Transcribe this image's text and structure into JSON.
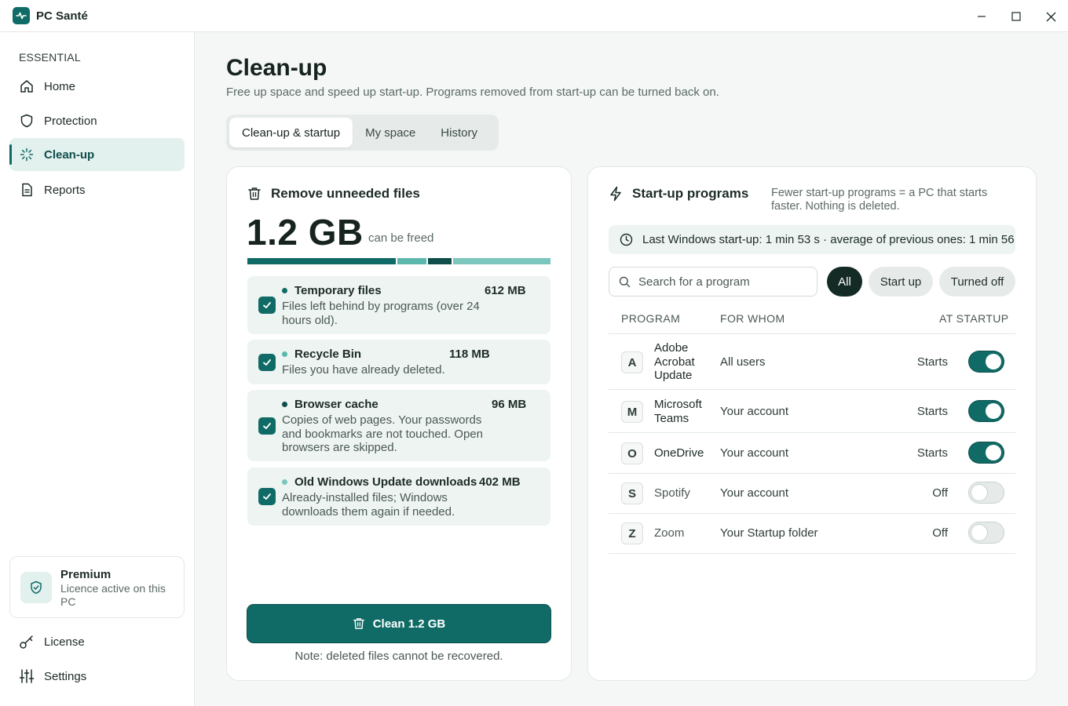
{
  "app": {
    "title": "PC Santé"
  },
  "sidebar": {
    "section_label": "ESSENTIAL",
    "items": [
      {
        "label": "Home",
        "icon": "home-icon"
      },
      {
        "label": "Protection",
        "icon": "shield-icon"
      },
      {
        "label": "Clean-up",
        "icon": "sparkle-icon",
        "active": true
      },
      {
        "label": "Reports",
        "icon": "document-icon"
      }
    ],
    "premium": {
      "title": "Premium",
      "subtitle": "Licence active on this PC"
    },
    "bottom_items": [
      {
        "label": "License",
        "icon": "key-icon"
      },
      {
        "label": "Settings",
        "icon": "sliders-icon"
      }
    ]
  },
  "page": {
    "title": "Clean-up",
    "subtitle": "Free up space and speed up start-up. Programs removed from start-up can be turned back on.",
    "tabs": [
      {
        "label": "Clean-up & startup",
        "active": true
      },
      {
        "label": "My space"
      },
      {
        "label": "History"
      }
    ]
  },
  "cleanup": {
    "heading": "Remove unneeded files",
    "total": "1.2 GB",
    "total_caption": "can be freed",
    "files": [
      {
        "title": "Temporary files",
        "size": "612 MB",
        "description": "Files left behind by programs (over 24 hours old).",
        "checked": true,
        "color": "#106b66"
      },
      {
        "title": "Recycle Bin",
        "size": "118 MB",
        "description": "Files you have already deleted.",
        "checked": true,
        "color": "#5cb8ad"
      },
      {
        "title": "Browser cache",
        "size": "96 MB",
        "description": "Copies of web pages. Your passwords and bookmarks are not touched. Open browsers are skipped.",
        "checked": true,
        "color": "#0f4e4a"
      },
      {
        "title": "Old Windows Update downloads",
        "size": "402 MB",
        "description": "Already-installed files; Windows downloads them again if needed.",
        "checked": true,
        "color": "#7cc6bd"
      }
    ],
    "button_label": "Clean 1.2 GB",
    "note": "Note: deleted files cannot be recovered."
  },
  "startup": {
    "heading": "Start-up programs",
    "subtitle": "Fewer start-up programs = a PC that starts faster. Nothing is deleted.",
    "last_boot": "Last Windows start-up: 1 min 53 s · average of previous ones: 1 min 56",
    "search_placeholder": "Search for a program",
    "filters": [
      {
        "label": "All",
        "active": true
      },
      {
        "label": "Start up"
      },
      {
        "label": "Turned off"
      }
    ],
    "columns": {
      "program": "PROGRAM",
      "for_whom": "FOR WHOM",
      "at_startup": "AT STARTUP"
    },
    "programs": [
      {
        "letter": "A",
        "name": "Adobe Acrobat Update",
        "for_whom": "All users",
        "state": "Starts",
        "enabled": true
      },
      {
        "letter": "M",
        "name": "Microsoft Teams",
        "for_whom": "Your account",
        "state": "Starts",
        "enabled": true
      },
      {
        "letter": "O",
        "name": "OneDrive",
        "for_whom": "Your account",
        "state": "Starts",
        "enabled": true
      },
      {
        "letter": "S",
        "name": "Spotify",
        "for_whom": "Your account",
        "state": "Off",
        "enabled": false
      },
      {
        "letter": "Z",
        "name": "Zoom",
        "for_whom": "Your Startup folder",
        "state": "Off",
        "enabled": false
      }
    ]
  }
}
